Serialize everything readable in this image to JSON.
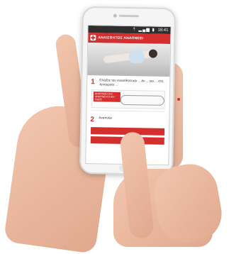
{
  "status": {
    "icons": "⇡ ▂▄▆ ▮",
    "time": "18:41"
  },
  "app": {
    "title": "ΑΝΑΙΣΘΗΤΟΣ ΑΝΑΠΝΕΕΙ",
    "accent": "#d32f2f"
  },
  "steps": [
    {
      "number": "1",
      "text": "Ελέγξτε τον αναισθητο και ... Αν ... για ... στη λειτουργία ..."
    },
    {
      "number": "2",
      "text": "Αναπνέει"
    }
  ],
  "illustration": {
    "badge_text": "ΑΝΑΠΝΟΗ ΚΑΙ ΑΝΑΠΝΕΥΣΤΙΚΗ ΟΔΟΣ"
  },
  "buttons": [
    {
      "label": ""
    },
    {
      "label": ""
    }
  ]
}
